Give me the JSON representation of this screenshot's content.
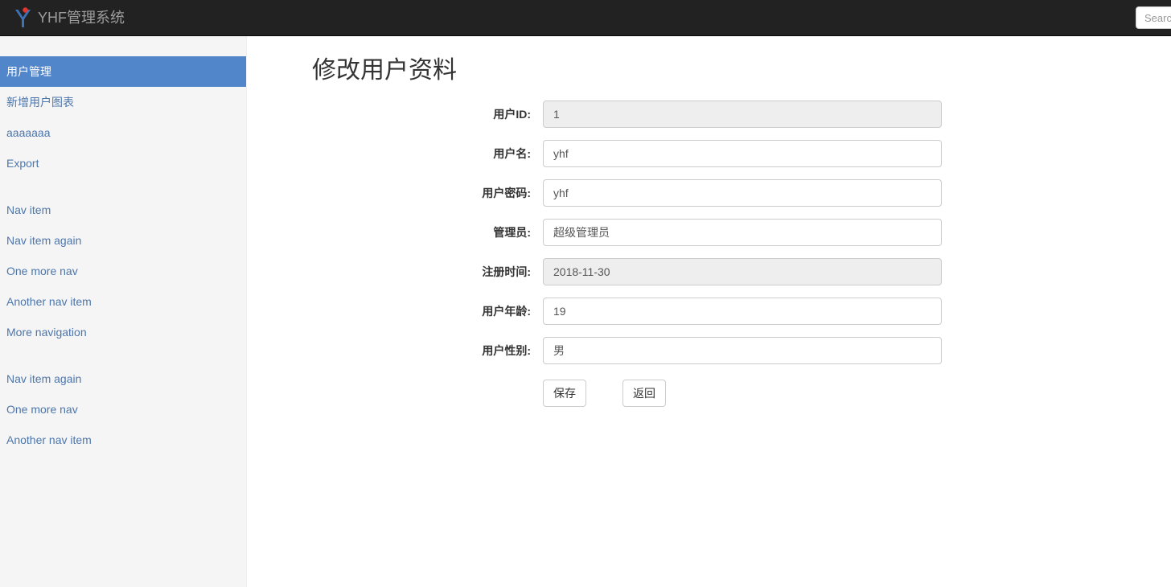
{
  "navbar": {
    "brand_text": "YHF管理系统",
    "logo_icon": "y-logo-icon",
    "search_placeholder": "Search",
    "search_value": ""
  },
  "sidebar": {
    "items": [
      {
        "label": "用户管理",
        "active": true,
        "group": 0
      },
      {
        "label": "新增用户图表",
        "active": false,
        "group": 0
      },
      {
        "label": "aaaaaaa",
        "active": false,
        "group": 0
      },
      {
        "label": "Export",
        "active": false,
        "group": 0
      },
      {
        "label": "Nav item",
        "active": false,
        "group": 1
      },
      {
        "label": "Nav item again",
        "active": false,
        "group": 1
      },
      {
        "label": "One more nav",
        "active": false,
        "group": 1
      },
      {
        "label": "Another nav item",
        "active": false,
        "group": 1
      },
      {
        "label": "More navigation",
        "active": false,
        "group": 1
      },
      {
        "label": "Nav item again",
        "active": false,
        "group": 2
      },
      {
        "label": "One more nav",
        "active": false,
        "group": 2
      },
      {
        "label": "Another nav item",
        "active": false,
        "group": 2
      }
    ]
  },
  "main": {
    "title": "修改用户资料",
    "fields": [
      {
        "label": "用户ID:",
        "value": "1",
        "disabled": true,
        "name": "user-id"
      },
      {
        "label": "用户名:",
        "value": "yhf",
        "disabled": false,
        "name": "user-name"
      },
      {
        "label": "用户密码:",
        "value": "yhf",
        "disabled": false,
        "name": "user-password"
      },
      {
        "label": "管理员:",
        "value": "超级管理员",
        "disabled": false,
        "name": "user-role"
      },
      {
        "label": "注册时间:",
        "value": "2018-11-30",
        "disabled": true,
        "name": "register-time"
      },
      {
        "label": "用户年龄:",
        "value": "19",
        "disabled": false,
        "name": "user-age"
      },
      {
        "label": "用户性别:",
        "value": "男",
        "disabled": false,
        "name": "user-gender"
      }
    ],
    "save_label": "保存",
    "back_label": "返回"
  },
  "colors": {
    "navbar_bg": "#222222",
    "brand_text": "#9d9d9d",
    "sidebar_bg": "#f5f5f5",
    "active_bg": "#5286ca",
    "link": "#4d76ab",
    "logo_blue": "#3b73b9",
    "logo_red": "#e8342a"
  }
}
